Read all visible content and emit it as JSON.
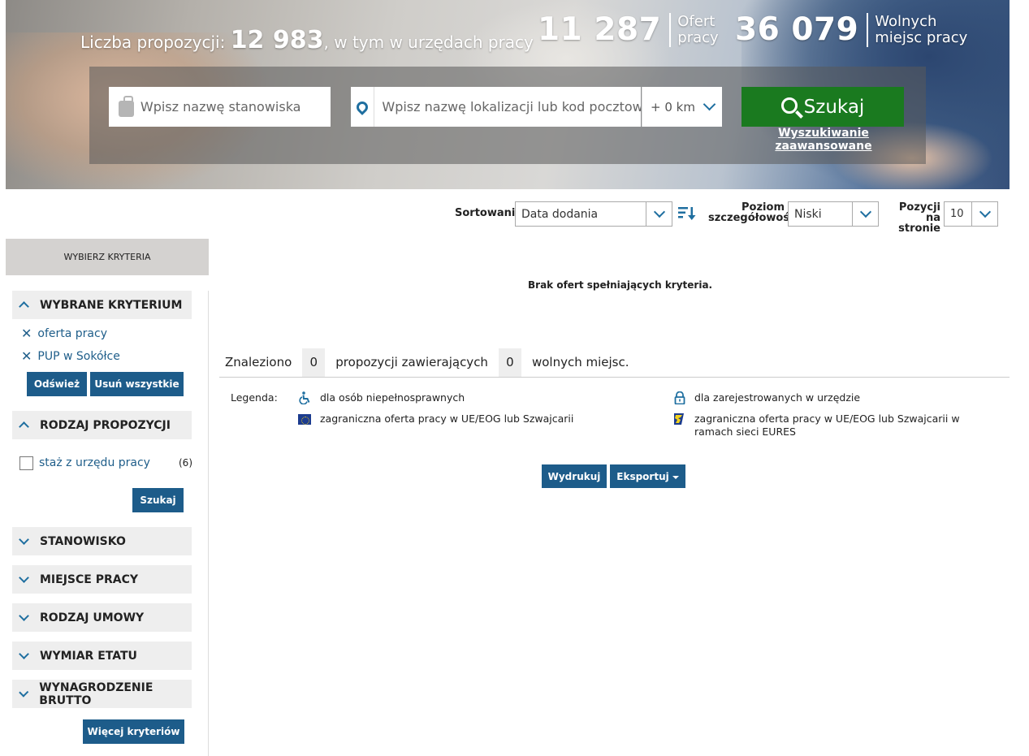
{
  "hero": {
    "total_prefix": "Liczba propozycji: ",
    "total_number": "12 983",
    "total_suffix": ", w tym w urzędach pracy",
    "offers_number": "11 287",
    "offers_label_1": "Ofert",
    "offers_label_2": "pracy",
    "vacancies_number": "36 079",
    "vacancies_label_1": "Wolnych",
    "vacancies_label_2": "miejsc pracy"
  },
  "search": {
    "job_placeholder": "Wpisz nazwę stanowiska",
    "location_placeholder": "Wpisz nazwę lokalizacji lub kod pocztowy",
    "distance": "+ 0 km",
    "button": "Szukaj",
    "advanced_link": "Wyszukiwanie zaawansowane"
  },
  "sort": {
    "sort_label": "Sortowanie",
    "sort_value": "Data dodania",
    "detail_label_1": "Poziom",
    "detail_label_2": "szczegółowości",
    "detail_value": "Niski",
    "per_page_label_1": "Pozycji",
    "per_page_label_2": "na stronie",
    "per_page_value": "10"
  },
  "sidebar": {
    "header": "WYBIERZ KRYTERIA",
    "selected_title": "WYBRANE KRYTERIUM",
    "selected_items": [
      "oferta pracy",
      "PUP w Sokółce"
    ],
    "refresh_button": "Odśwież",
    "remove_all_button": "Usuń wszystkie",
    "type_title": "RODZAJ PROPOZYCJI",
    "type_option": "staż z urzędu pracy",
    "type_option_count": "(6)",
    "type_search_button": "Szukaj",
    "sections": [
      "STANOWISKO",
      "MIEJSCE PRACY",
      "RODZAJ UMOWY",
      "WYMIAR ETATU",
      "WYNAGRODZENIE BRUTTO"
    ],
    "more_button": "Więcej kryteriów"
  },
  "main": {
    "no_offers": "Brak ofert spełniających kryteria.",
    "found_prefix": "Znaleziono",
    "found_count": "0",
    "found_middle": "propozycji zawierających",
    "found_vacancies": "0",
    "found_suffix": "wolnych miejsc.",
    "legend_label": "Legenda:",
    "legend_disabled": "dla osób niepełnosprawnych",
    "legend_registered": "dla zarejestrowanych w urzędzie",
    "legend_eu": "zagraniczna oferta pracy w UE/EOG lub Szwajcarii",
    "legend_eures": "zagraniczna oferta pracy w UE/EOG lub Szwajcarii w ramach sieci EURES",
    "print_button": "Wydrukuj",
    "export_button": "Eksportuj"
  },
  "colors": {
    "primary_blue": "#1d5c8a",
    "search_green": "#1a7a1f",
    "accent_icon": "#1f6fa0"
  }
}
